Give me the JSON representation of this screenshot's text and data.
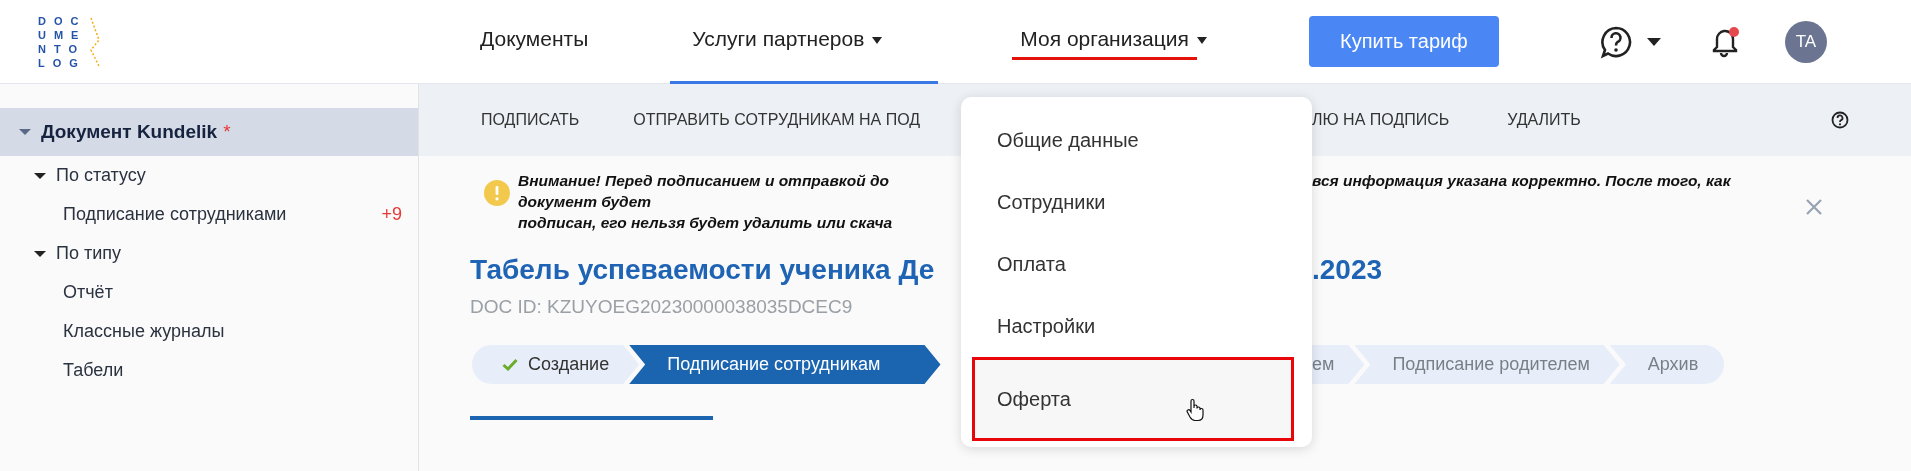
{
  "logo": {
    "rows": [
      "DOC",
      "UME",
      "NTO",
      "LOG"
    ]
  },
  "nav": [
    {
      "label": "Документы",
      "selected": false,
      "dropdown": false,
      "highlighted": false
    },
    {
      "label": "Услуги партнеров",
      "selected": true,
      "dropdown": true,
      "highlighted": false
    },
    {
      "label": "Моя организация",
      "selected": false,
      "dropdown": true,
      "highlighted": true
    }
  ],
  "buy_button": "Купить тариф",
  "notifications": {
    "unread": true
  },
  "avatar": "TA",
  "sidebar": {
    "tree": [
      {
        "label": "Документ Kundelik",
        "mark": "*",
        "expanded": true,
        "selected": true,
        "children": [
          {
            "label": "По статусу",
            "expanded": true,
            "children": [
              {
                "label": "Подписание сотрудниками",
                "badge": "+9"
              }
            ]
          },
          {
            "label": "По типу",
            "expanded": true,
            "children": [
              {
                "label": "Отчёт"
              },
              {
                "label": "Классные журналы"
              },
              {
                "label": "Табели"
              }
            ]
          }
        ]
      }
    ]
  },
  "toolbar": {
    "before": [
      "ПОДПИСАТЬ",
      "ОТПРАВИТЬ СОТРУДНИКАМ НА ПОД"
    ],
    "after": [
      "ЛЮ НА ПОДПИСЬ",
      "УДАЛИТЬ"
    ]
  },
  "warning": {
    "lines": [
      "Внимание! Перед подписанием и отправкой до",
      "документ будет",
      "подписан, его нельзя будет удалить или скача"
    ],
    "continued": "вся информация указана корректно. После того, как"
  },
  "document": {
    "title_before": "Табель успеваемости ученика Де",
    "title_after": ".2023",
    "doc_id": "DOC ID: KZUYOEG20230000038035DCEC9"
  },
  "stepper": {
    "before": [
      {
        "label": "Создание",
        "completed": true,
        "selected": false
      },
      {
        "label": "Подписание сотрудникам",
        "completed": false,
        "selected": true
      }
    ],
    "after": [
      {
        "label": "ем",
        "completed": false,
        "selected": false
      },
      {
        "label": "Подписание родителем",
        "completed": false,
        "selected": false
      },
      {
        "label": "Архив",
        "completed": false,
        "selected": false
      }
    ]
  },
  "dropdown": {
    "items": [
      {
        "label": "Общие данные",
        "highlighted": false,
        "hovered": false
      },
      {
        "label": "Сотрудники",
        "highlighted": false,
        "hovered": false
      },
      {
        "label": "Оплата",
        "highlighted": false,
        "hovered": false
      },
      {
        "label": "Настройки",
        "highlighted": false,
        "hovered": false
      },
      {
        "label": "Оферта",
        "highlighted": true,
        "hovered": true
      }
    ]
  }
}
